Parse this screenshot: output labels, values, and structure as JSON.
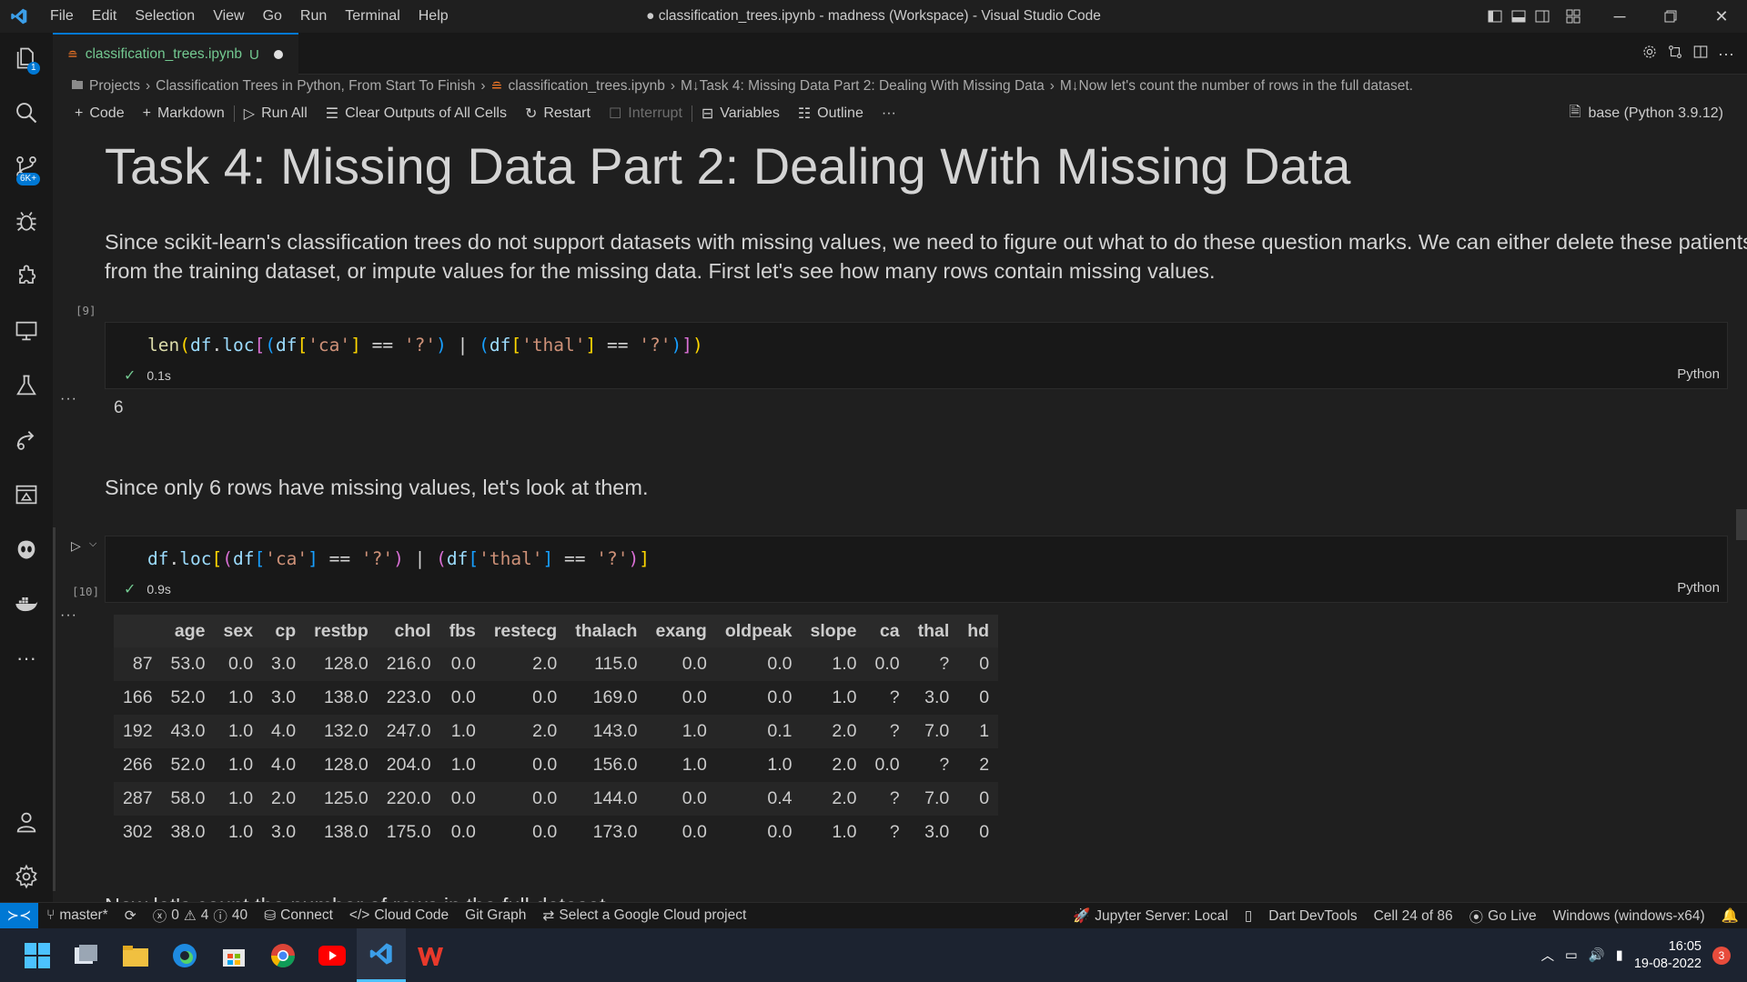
{
  "menu": {
    "items": [
      "File",
      "Edit",
      "Selection",
      "View",
      "Go",
      "Run",
      "Terminal",
      "Help"
    ]
  },
  "window": {
    "title": "● classification_trees.ipynb - madness (Workspace) - Visual Studio Code"
  },
  "activity": {
    "explorer_badge": "1",
    "source_control_badge": "6K+"
  },
  "tab": {
    "filename": "classification_trees.ipynb",
    "status": "U"
  },
  "breadcrumb": [
    "Projects",
    "Classification Trees in Python, From Start To Finish",
    "classification_trees.ipynb",
    "M↓Task 4: Missing Data Part 2: Dealing With Missing Data",
    "M↓Now let's count the number of rows in the full dataset."
  ],
  "toolbar": {
    "code": "Code",
    "markdown": "Markdown",
    "run_all": "Run All",
    "clear_outputs": "Clear Outputs of All Cells",
    "restart": "Restart",
    "interrupt": "Interrupt",
    "variables": "Variables",
    "outline": "Outline",
    "kernel": "base (Python 3.9.12)"
  },
  "notebook": {
    "heading": "Task 4: Missing Data Part 2: Dealing With Missing Data",
    "para1": "Since scikit-learn's classification trees do not support datasets with missing values, we need to figure out what to do these question marks. We can either delete these patients from the training dataset, or impute values for the missing data. First let's see how many rows contain missing values.",
    "cell1": {
      "exec": "[9]",
      "time": "0.1s",
      "lang": "Python",
      "output": "6"
    },
    "para2": "Since only 6 rows have missing values, let's look at them.",
    "cell2": {
      "exec": "[10]",
      "time": "0.9s",
      "lang": "Python"
    },
    "cut_text": "Now let's count the number of rows in the full dataset."
  },
  "table": {
    "columns": [
      "",
      "age",
      "sex",
      "cp",
      "restbp",
      "chol",
      "fbs",
      "restecg",
      "thalach",
      "exang",
      "oldpeak",
      "slope",
      "ca",
      "thal",
      "hd"
    ],
    "rows": [
      [
        "87",
        "53.0",
        "0.0",
        "3.0",
        "128.0",
        "216.0",
        "0.0",
        "2.0",
        "115.0",
        "0.0",
        "0.0",
        "1.0",
        "0.0",
        "?",
        "0"
      ],
      [
        "166",
        "52.0",
        "1.0",
        "3.0",
        "138.0",
        "223.0",
        "0.0",
        "0.0",
        "169.0",
        "0.0",
        "0.0",
        "1.0",
        "?",
        "3.0",
        "0"
      ],
      [
        "192",
        "43.0",
        "1.0",
        "4.0",
        "132.0",
        "247.0",
        "1.0",
        "2.0",
        "143.0",
        "1.0",
        "0.1",
        "2.0",
        "?",
        "7.0",
        "1"
      ],
      [
        "266",
        "52.0",
        "1.0",
        "4.0",
        "128.0",
        "204.0",
        "1.0",
        "0.0",
        "156.0",
        "1.0",
        "1.0",
        "2.0",
        "0.0",
        "?",
        "2"
      ],
      [
        "287",
        "58.0",
        "1.0",
        "2.0",
        "125.0",
        "220.0",
        "0.0",
        "0.0",
        "144.0",
        "0.0",
        "0.4",
        "2.0",
        "?",
        "7.0",
        "0"
      ],
      [
        "302",
        "38.0",
        "1.0",
        "3.0",
        "138.0",
        "175.0",
        "0.0",
        "0.0",
        "173.0",
        "0.0",
        "0.0",
        "1.0",
        "?",
        "3.0",
        "0"
      ]
    ]
  },
  "statusbar": {
    "branch": "master*",
    "errors": "0",
    "warnings": "4",
    "info": "40",
    "connect": "Connect",
    "cloud_code": "Cloud Code",
    "git_graph": "Git Graph",
    "gcloud": "Select a Google Cloud project",
    "jupyter": "Jupyter Server: Local",
    "dart": "Dart DevTools",
    "cell_pos": "Cell 24 of 86",
    "go_live": "Go Live",
    "platform": "Windows (windows-x64)"
  },
  "taskbar": {
    "time": "16:05",
    "date": "19-08-2022",
    "notifications": "3"
  },
  "colors": {
    "accent": "#0078d4",
    "untracked": "#73c991",
    "success": "#73c991"
  }
}
